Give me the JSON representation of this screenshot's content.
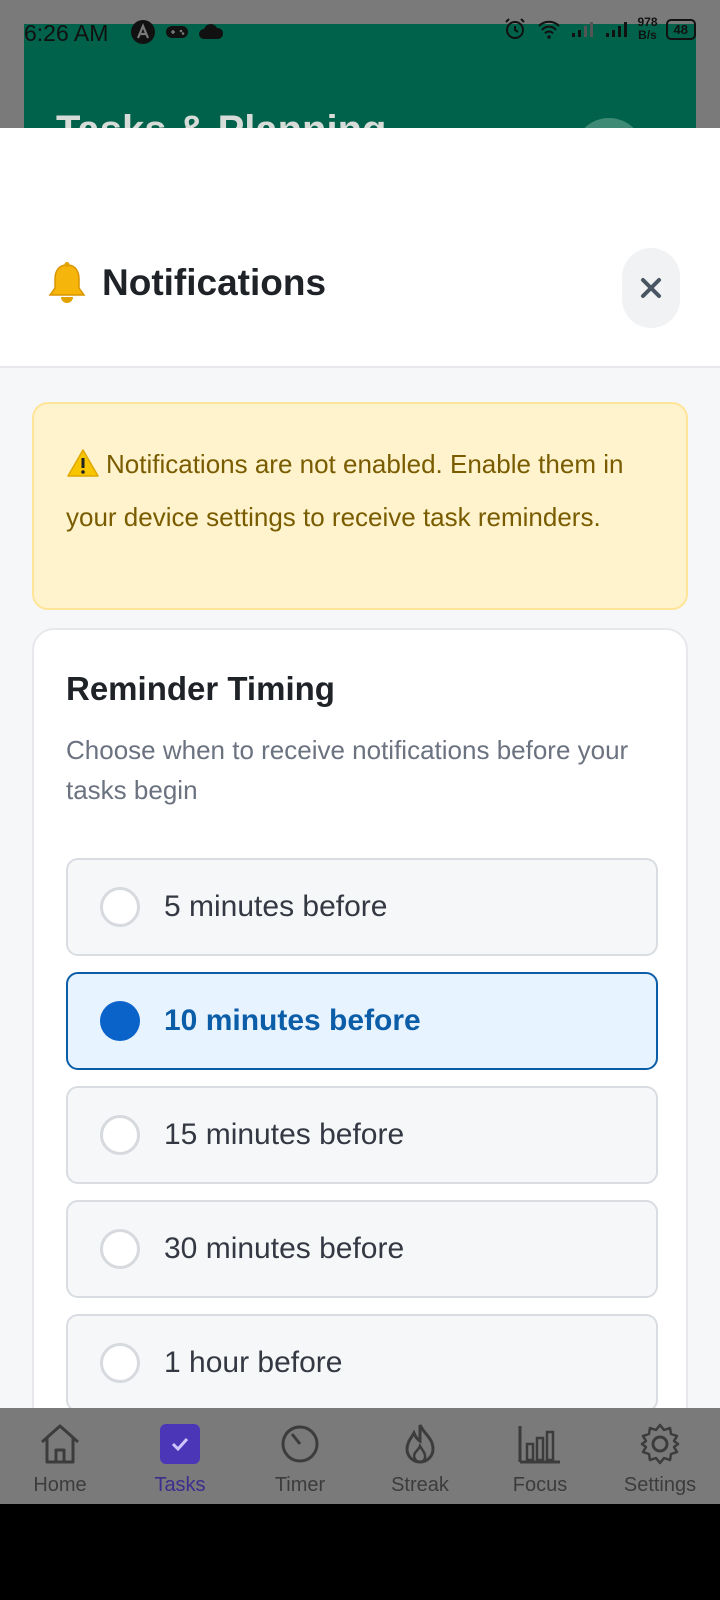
{
  "status_bar": {
    "time": "6:26 AM",
    "net_speed_value": "978",
    "net_speed_unit": "B/s",
    "battery": "48"
  },
  "background": {
    "title": "Tasks & Planning"
  },
  "sheet": {
    "title": "Notifications",
    "warning": "Notifications are not enabled. Enable them in your device settings to receive task reminders.",
    "reminder": {
      "title": "Reminder Timing",
      "description": "Choose when to receive notifications before your tasks begin",
      "options": [
        {
          "label": "5 minutes before",
          "selected": false
        },
        {
          "label": "10 minutes before",
          "selected": true
        },
        {
          "label": "15 minutes before",
          "selected": false
        },
        {
          "label": "30 minutes before",
          "selected": false
        },
        {
          "label": "1 hour before",
          "selected": false
        }
      ]
    }
  },
  "nav": {
    "items": [
      {
        "label": "Home",
        "icon": "home-icon"
      },
      {
        "label": "Tasks",
        "icon": "checkbox-icon",
        "active": true
      },
      {
        "label": "Timer",
        "icon": "timer-icon"
      },
      {
        "label": "Streak",
        "icon": "flame-icon"
      },
      {
        "label": "Focus",
        "icon": "bar-chart-icon"
      },
      {
        "label": "Settings",
        "icon": "gear-icon"
      }
    ]
  },
  "colors": {
    "accent": "#0b5da8",
    "header_green": "#00624a",
    "warning_bg": "#fff3cd",
    "warning_text": "#7a5c00",
    "nav_active": "#4b36b8"
  }
}
